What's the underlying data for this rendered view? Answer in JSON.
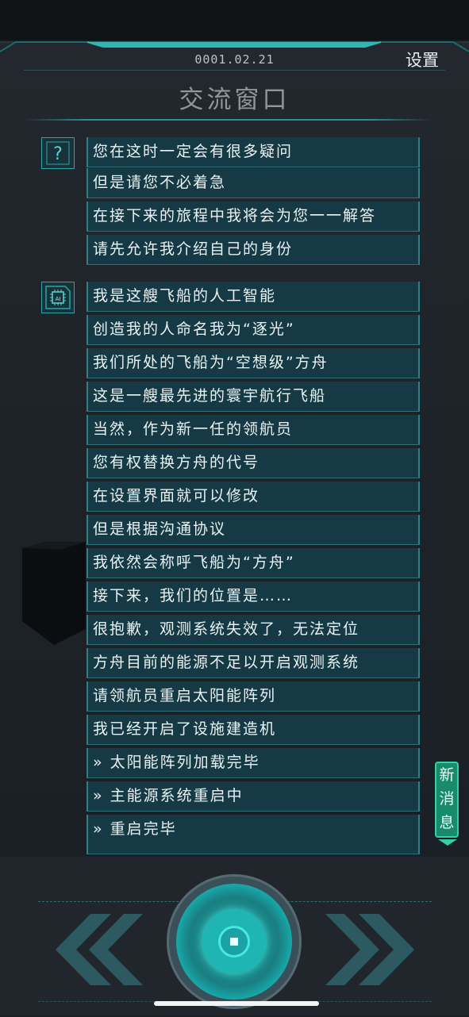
{
  "header": {
    "date": "0001.02.21",
    "settings_label": "设置",
    "title": "交流窗口"
  },
  "icons": {
    "question": "question-mark-icon",
    "ai": "ai-chip-icon"
  },
  "groups": [
    {
      "speaker_icon": "question-mark-icon",
      "messages": [
        "您在这时一定会有很多疑问",
        "但是请您不必着急",
        "在接下来的旅程中我将会为您一一解答",
        "请先允许我介绍自己的身份"
      ]
    },
    {
      "speaker_icon": "ai-chip-icon",
      "messages": [
        "我是这艘飞船的人工智能",
        "创造我的人命名我为“逐光”",
        "我们所处的飞船为“空想级”方舟",
        "这是一艘最先进的寰宇航行飞船",
        "当然，作为新一任的领航员",
        "您有权替换方舟的代号",
        "在设置界面就可以修改",
        "但是根据沟通协议",
        "我依然会称呼飞船为“方舟”",
        "接下来，我们的位置是……",
        "很抱歉，观测系统失效了，无法定位",
        "方舟目前的能源不足以开启观测系统",
        "请领航员重启太阳能阵列",
        "我已经开启了设施建造机",
        "» 太阳能阵列加载完毕",
        "» 主能源系统重启中",
        "» 重启完毕"
      ]
    }
  ],
  "new_message_badge": {
    "chars": [
      "新",
      "消",
      "息"
    ]
  },
  "colors": {
    "accent": "#2fd8d4",
    "message_bg": "#163a45",
    "badge": "#1a8a6c"
  }
}
